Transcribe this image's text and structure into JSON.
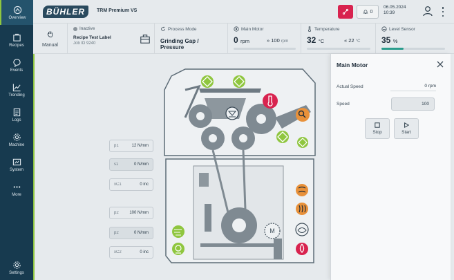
{
  "sidebar": {
    "items": [
      {
        "label": "Overview"
      },
      {
        "label": "Recipes"
      },
      {
        "label": "Events"
      },
      {
        "label": "Trending"
      },
      {
        "label": "Logs"
      },
      {
        "label": "Machine"
      },
      {
        "label": "System"
      },
      {
        "label": "More"
      },
      {
        "label": "Settings"
      }
    ]
  },
  "header": {
    "brand": "BÜHLER",
    "machine_name": "TRM Premium VS",
    "notification_count": "0",
    "date": "06.05.2024",
    "time": "10:39"
  },
  "status": {
    "mode_label": "Manual",
    "state": "Inactive",
    "recipe": "Recipe Test Label",
    "job": "Job ID 9240",
    "process_mode_label": "Process Mode",
    "process_mode_value": "Grinding Gap / Pressure",
    "main_motor_label": "Main Motor",
    "main_motor_value": "0",
    "main_motor_unit": "rpm",
    "main_motor_target": "» 100",
    "main_motor_target_unit": "rpm",
    "temperature_label": "Temperature",
    "temperature_value": "32",
    "temperature_unit": "°C",
    "temperature_target": "« 22",
    "temperature_target_unit": "°C",
    "level_label": "Level Sensor",
    "level_value": "35",
    "level_unit": "%",
    "level_fraction": 0.35
  },
  "values": {
    "p1": {
      "key": "p1",
      "value": "12 N/mm"
    },
    "s1": {
      "key": "s1",
      "value": "0 N/mm"
    },
    "xc1": {
      "key": "xC1",
      "value": "0 inc"
    },
    "p2": {
      "key": "p2",
      "value": "100 N/mm"
    },
    "s2": {
      "key": "p2",
      "value": "0 N/mm"
    },
    "xc2": {
      "key": "xC2",
      "value": "0 inc"
    }
  },
  "panel": {
    "title": "Main Motor",
    "actual_speed_label": "Actual Speed",
    "actual_speed_value": "0  rpm",
    "speed_label": "Speed",
    "speed_value": "100",
    "stop_label": "Stop",
    "start_label": "Start"
  },
  "colors": {
    "sidebar": "#173a4f",
    "accent_green": "#8fc63f",
    "alert_red": "#d8234f",
    "orange": "#e8913a",
    "teal": "#2a9c8c"
  }
}
